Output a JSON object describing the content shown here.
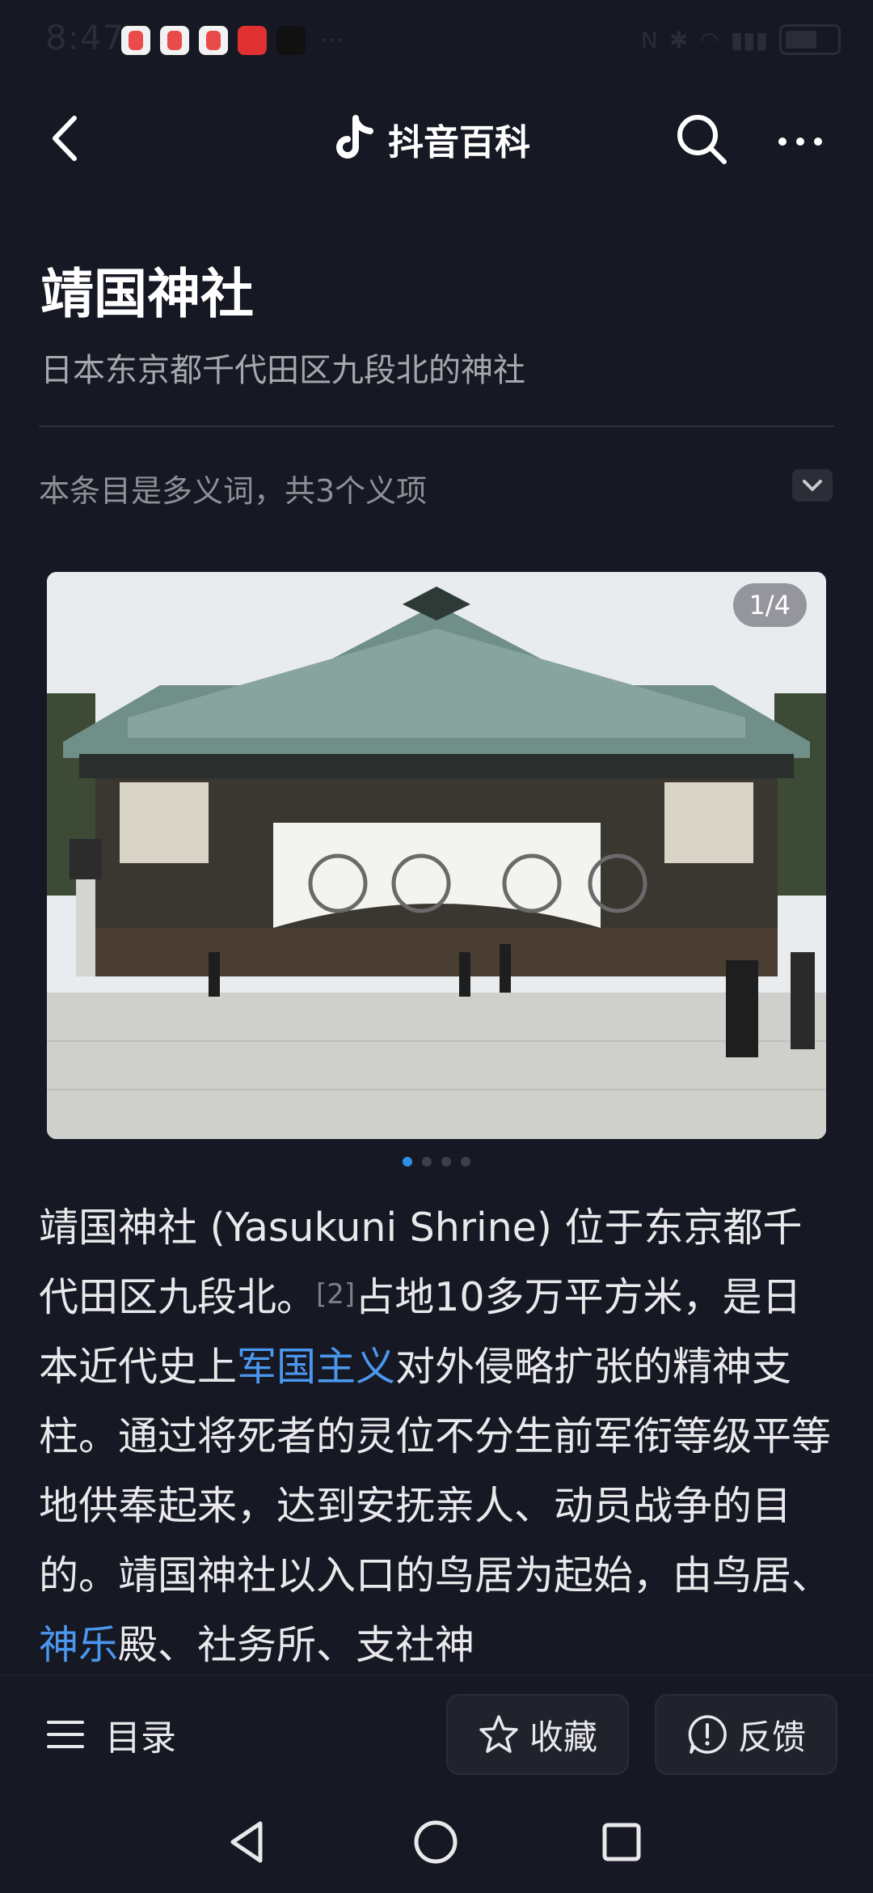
{
  "status": {
    "time": "8:47",
    "app_icons": [
      "app-icon",
      "app-icon",
      "app-icon",
      "xiaohongshu-icon",
      "tiktok-icon"
    ],
    "more": "···"
  },
  "header": {
    "brand": "抖音百科"
  },
  "article": {
    "title": "靖国神社",
    "subtitle": "日本东京都千代田区九段北的神社",
    "polysemy": "本条目是多义词，共3个义项",
    "gallery_counter": "1/4",
    "gallery_total": 4,
    "gallery_active": 1,
    "body": {
      "p1": "靖国神社 (Yasukuni Shrine) 位于东京都千代田区九段北。",
      "ref": "[2]",
      "p2": "占地10多万平方米，是日本近代史上",
      "link1": "军国主义",
      "p3": "对外侵略扩张的精神支柱。通过将死者的灵位不分生前军衔等级平等地供奉起来，达到安抚亲人、动员战争的目的。靖国神社以入口的鸟居为起始，由鸟居、",
      "link2": "神乐",
      "p4": "殿、社务所、支社神"
    }
  },
  "bottom": {
    "toc": "目录",
    "collect": "收藏",
    "feedback": "反馈"
  },
  "colors": {
    "background": "#161823",
    "link": "#4b97ee",
    "accent_dot": "#2d8fe6"
  }
}
